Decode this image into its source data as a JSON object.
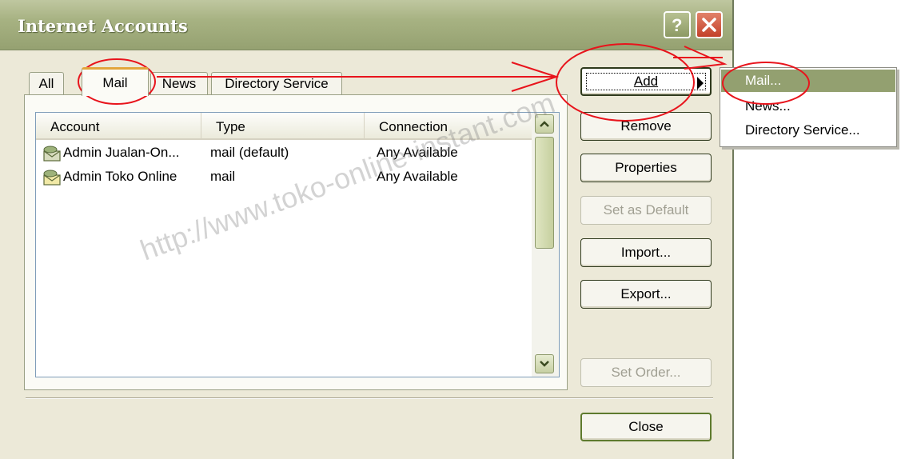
{
  "window": {
    "title": "Internet Accounts"
  },
  "tabs": [
    {
      "label": "All"
    },
    {
      "label": "Mail"
    },
    {
      "label": "News"
    },
    {
      "label": "Directory Service"
    }
  ],
  "list": {
    "columns": [
      "Account",
      "Type",
      "Connection"
    ],
    "rows": [
      {
        "account": "Admin Jualan-On...",
        "type": "mail (default)",
        "connection": "Any Available"
      },
      {
        "account": "Admin Toko Online",
        "type": "mail",
        "connection": "Any Available"
      }
    ]
  },
  "buttons": {
    "add": "Add",
    "remove": "Remove",
    "properties": "Properties",
    "set_default": "Set as Default",
    "import": "Import...",
    "export": "Export...",
    "set_order": "Set Order...",
    "close": "Close"
  },
  "menu": {
    "items": [
      "Mail...",
      "News...",
      "Directory Service..."
    ]
  },
  "watermark": "http://www.toko-online-instant.com",
  "colors": {
    "title_bar": "#a7b282",
    "face": "#ece9d8",
    "menu_highlight": "#93a070",
    "annotation": "#e8141c"
  }
}
